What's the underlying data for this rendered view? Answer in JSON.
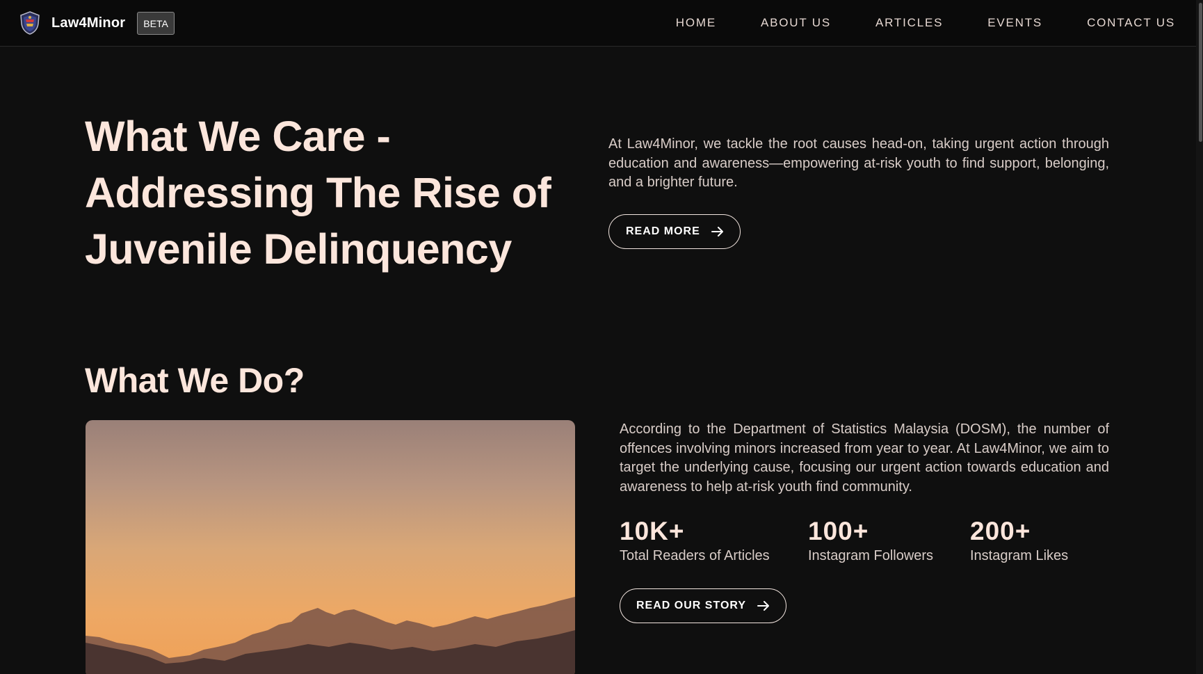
{
  "nav": {
    "brand_name": "Law4Minor",
    "badge": "BETA",
    "links": [
      "HOME",
      "ABOUT US",
      "ARTICLES",
      "EVENTS",
      "CONTACT US"
    ]
  },
  "hero": {
    "title_line1": "What We Care -",
    "title_line2": "Addressing The Rise of",
    "title_line3": "Juvenile Delinquency",
    "description": "At Law4Minor, we tackle the root causes head-on, taking urgent action through education and awareness—empowering at-risk youth to find support, belonging, and a brighter future.",
    "button_label": "READ MORE"
  },
  "what_we_do": {
    "title": "What We Do?",
    "description": "According to the Department of Statistics Malaysia (DOSM), the number of offences involving minors increased from year to year. At Law4Minor, we aim to target the underlying cause, focusing our urgent action towards education and awareness to help at-risk youth find community.",
    "stats": [
      {
        "value": "10K+",
        "label": "Total Readers of Articles"
      },
      {
        "value": "100+",
        "label": "Instagram Followers"
      },
      {
        "value": "200+",
        "label": "Instagram Likes"
      }
    ],
    "button_label": "READ OUR STORY"
  },
  "icons": {
    "logo": "shield-logo-icon",
    "button_arrow": "arrow-right-icon"
  },
  "colors": {
    "background": "#0f0f0f",
    "heading": "#fce6dc",
    "body_text": "#d9cdc8"
  }
}
